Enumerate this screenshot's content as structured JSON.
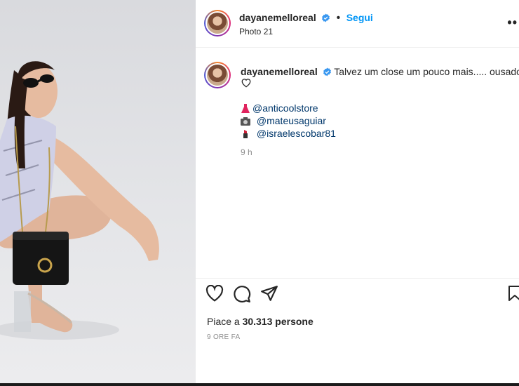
{
  "post": {
    "username": "dayanemelloreal",
    "follow_label": "Segui",
    "photo_index": "Photo 21",
    "more_label": "•••"
  },
  "caption": {
    "username": "dayanemelloreal",
    "text": "Talvez um close um pouco mais..... ousado",
    "mentions": [
      {
        "emoji": "dress-emoji",
        "handle": "@anticoolstore"
      },
      {
        "emoji": "camera-emoji",
        "handle": "@mateusaguiar"
      },
      {
        "emoji": "lipstick-emoji",
        "handle": "@israelescobar81"
      }
    ],
    "time": "9 h"
  },
  "engagement": {
    "likes_prefix": "Piace a ",
    "likes_count": "30.313",
    "likes_suffix": " persone",
    "posted_ago": "9 ORE FA"
  },
  "colors": {
    "accent": "#0095f6",
    "mention": "#00376b",
    "verified": "#3897f0",
    "muted": "#8e8e8e"
  }
}
